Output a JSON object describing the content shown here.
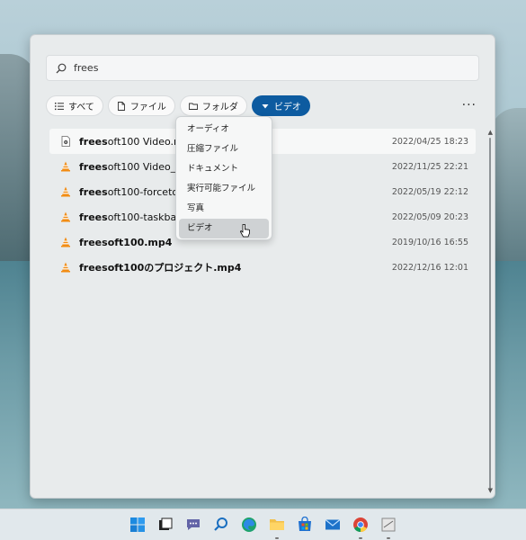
{
  "search": {
    "value": "frees"
  },
  "filters": [
    {
      "label": "すべて",
      "icon": "list-icon",
      "active": false
    },
    {
      "label": "ファイル",
      "icon": "file-icon",
      "active": false
    },
    {
      "label": "フォルダ",
      "icon": "folder-icon",
      "active": false
    },
    {
      "label": "ビデオ",
      "icon": "chevron-down-icon",
      "active": true
    }
  ],
  "more_label": "···",
  "results": [
    {
      "name_bold": "frees",
      "name_rest": "oft100 Video.m",
      "date": "2022/04/25 18:23",
      "icon": "video-file-icon",
      "selected": true
    },
    {
      "name_bold": "frees",
      "name_rest": "oft100 Video_2",
      "date": "2022/11/25 22:21",
      "icon": "vlc-icon",
      "selected": false
    },
    {
      "name_bold": "frees",
      "name_rest": "oft100-forcetoc",
      "date": "2022/05/19 22:12",
      "icon": "vlc-icon",
      "selected": false
    },
    {
      "name_bold": "frees",
      "name_rest": "oft100-taskbar1",
      "date": "2022/05/09 20:23",
      "icon": "vlc-icon",
      "selected": false
    },
    {
      "name_bold": "frees",
      "name_rest": "oft100.mp4",
      "date": "2019/10/16 16:55",
      "icon": "vlc-icon",
      "selected": false
    },
    {
      "name_bold": "frees",
      "name_rest": "oft100のプロジェクト.mp4",
      "date": "2022/12/16 12:01",
      "icon": "vlc-icon",
      "selected": false
    }
  ],
  "dropdown": {
    "options": [
      "オーディオ",
      "圧縮ファイル",
      "ドキュメント",
      "実行可能ファイル",
      "写真",
      "ビデオ"
    ],
    "selected": "ビデオ"
  },
  "taskbar": [
    "start-icon",
    "task-view-icon",
    "teams-chat-icon",
    "search-icon",
    "edge-icon",
    "file-explorer-icon",
    "store-icon",
    "mail-icon",
    "chrome-icon",
    "app-icon"
  ],
  "colors": {
    "accent": "#0d5ba0",
    "vlc": "#f28c13"
  }
}
